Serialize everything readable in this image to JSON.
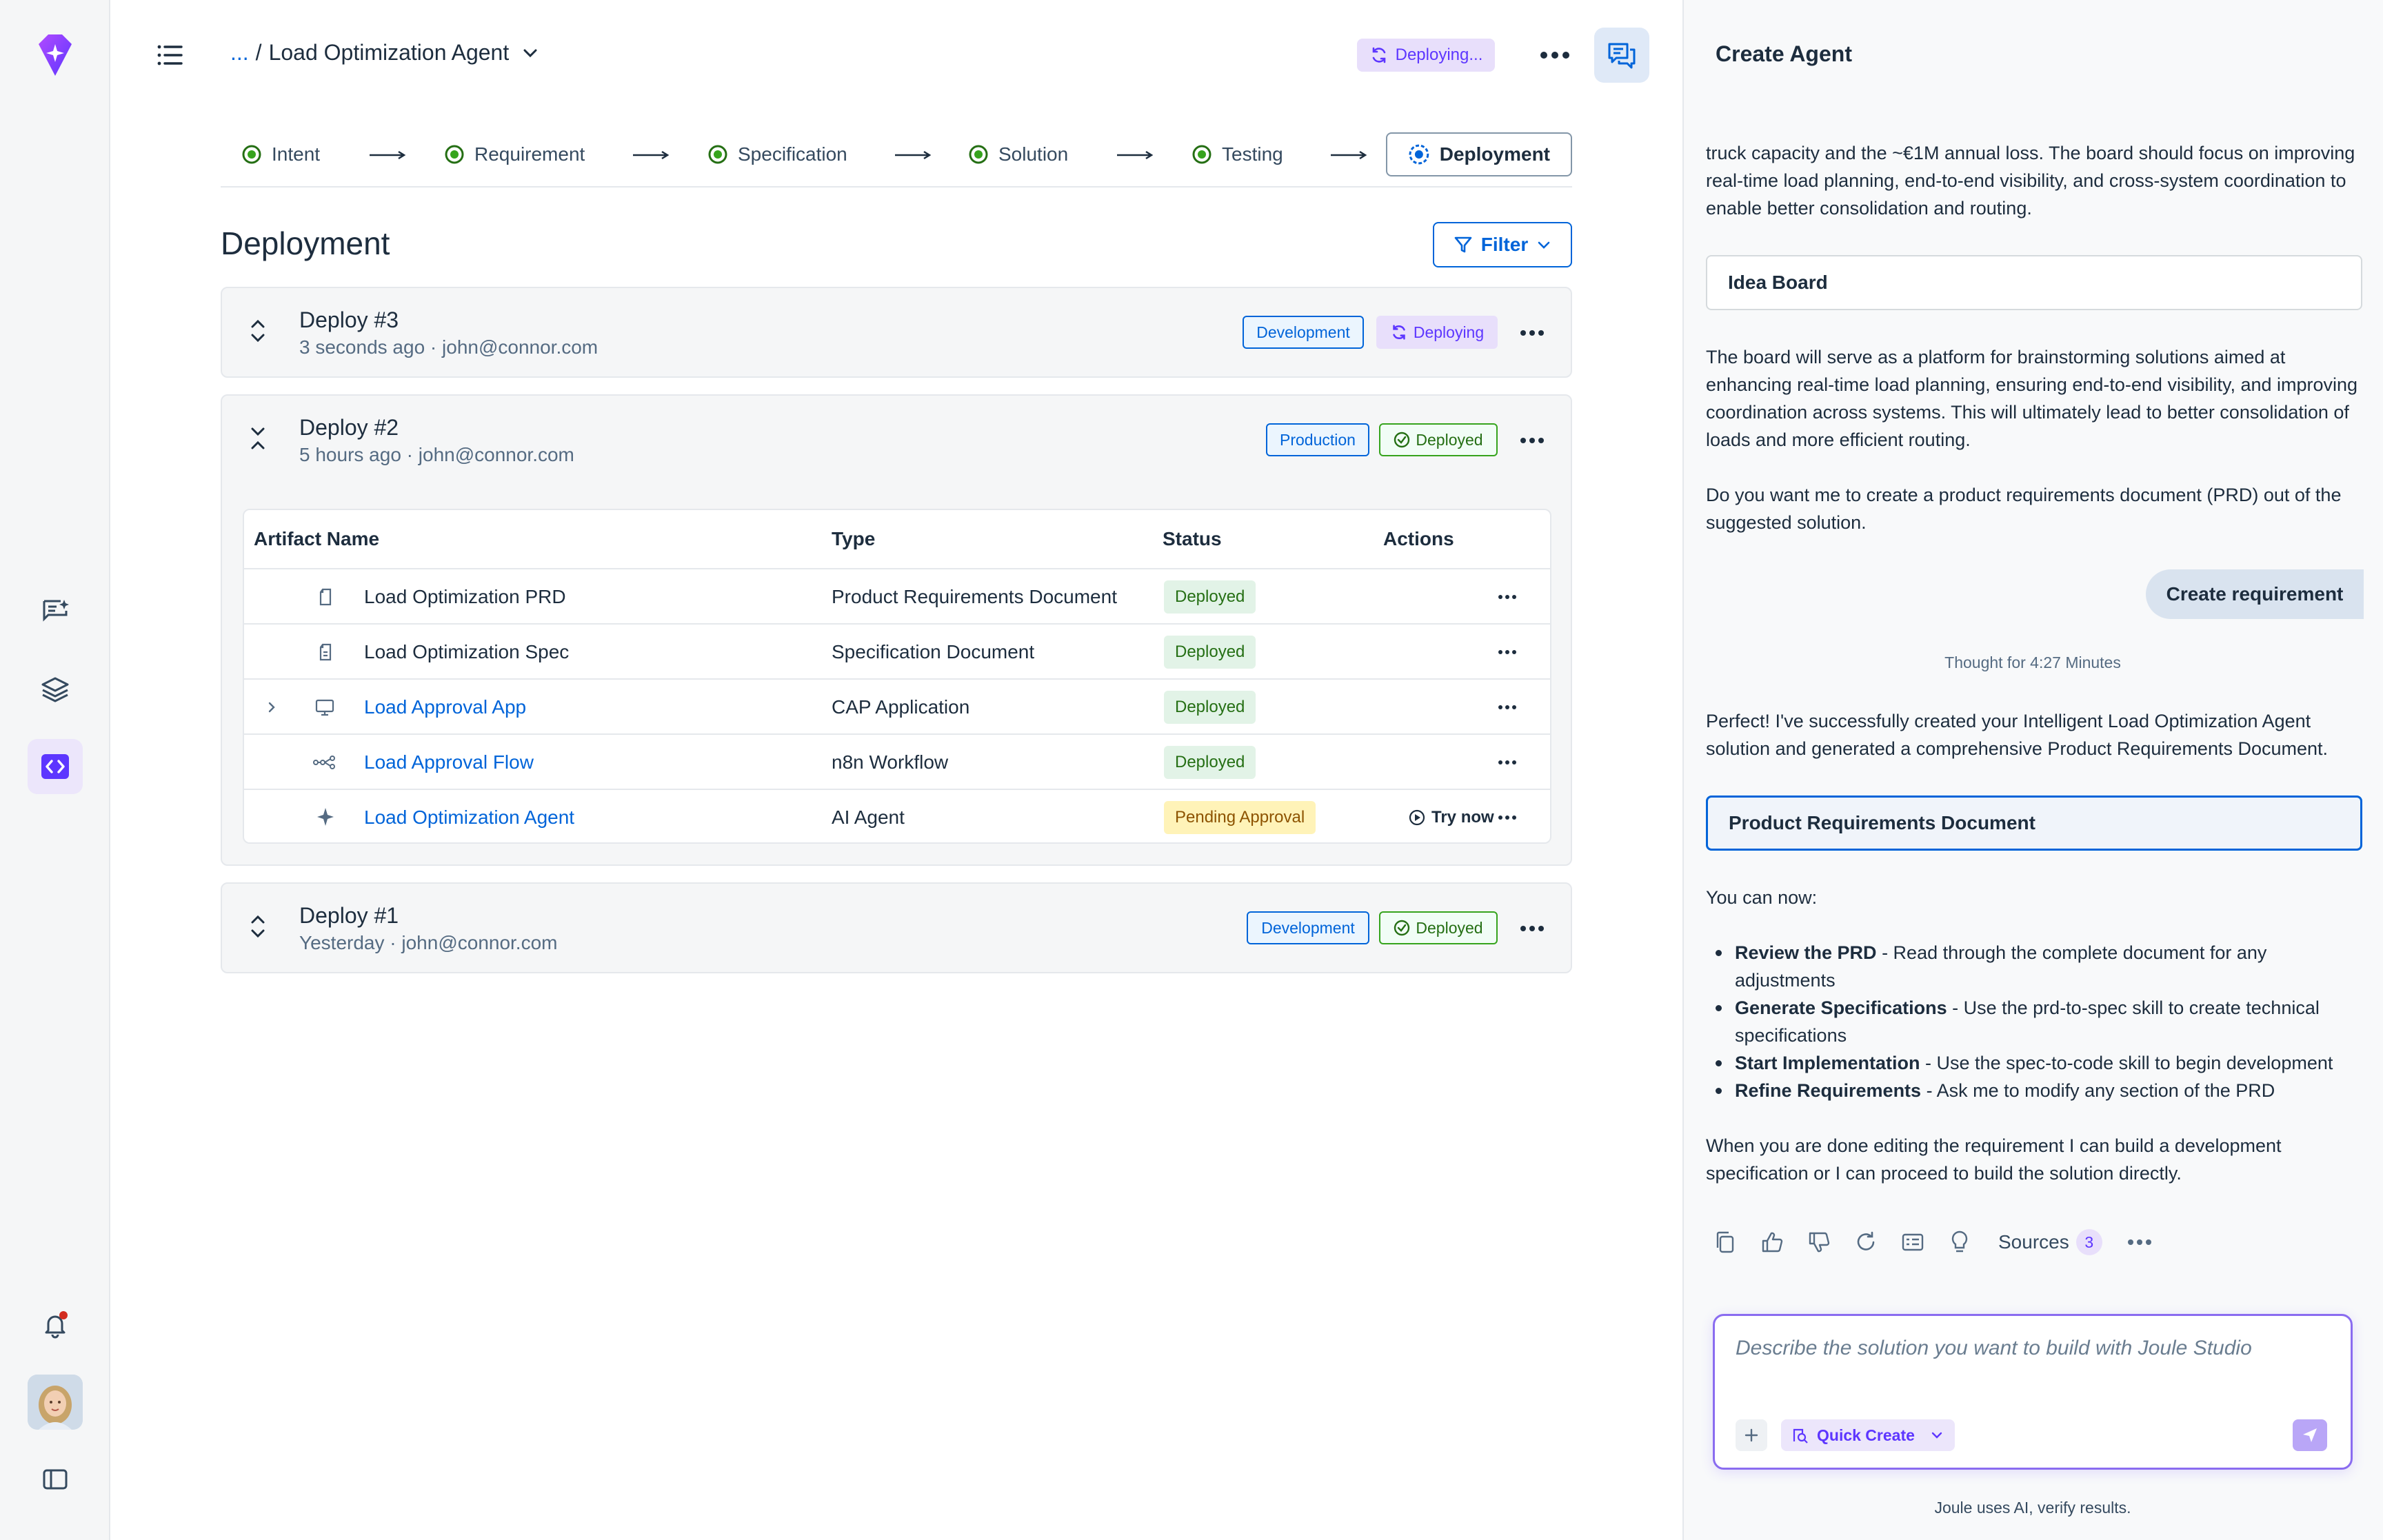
{
  "topbar": {
    "breadcrumb_prefix": "...",
    "breadcrumb_sep": "/",
    "title": "Load Optimization Agent",
    "status_pill": "Deploying..."
  },
  "stepper": [
    {
      "label": "Intent",
      "state": "done"
    },
    {
      "label": "Requirement",
      "state": "done"
    },
    {
      "label": "Specification",
      "state": "done"
    },
    {
      "label": "Solution",
      "state": "done"
    },
    {
      "label": "Testing",
      "state": "done"
    },
    {
      "label": "Deployment",
      "state": "current"
    }
  ],
  "main": {
    "section_title": "Deployment",
    "filter_label": "Filter"
  },
  "deploys": [
    {
      "title": "Deploy #3",
      "subtitle": "3 seconds ago · john@connor.com",
      "env": "Development",
      "status": "Deploying"
    },
    {
      "title": "Deploy #2",
      "subtitle": "5 hours ago · john@connor.com",
      "env": "Production",
      "status": "Deployed"
    },
    {
      "title": "Deploy #1",
      "subtitle": "Yesterday · john@connor.com",
      "env": "Development",
      "status": "Deployed"
    }
  ],
  "artifacts": {
    "columns": [
      "Artifact Name",
      "Type",
      "Status",
      "Actions"
    ],
    "rows": [
      {
        "name": "Load Optimization PRD",
        "type": "Product Requirements Document",
        "status": "Deployed",
        "icon": "document-icon",
        "link": false
      },
      {
        "name": "Load Optimization Spec",
        "type": "Specification Document",
        "status": "Deployed",
        "icon": "spec-document-icon",
        "link": false
      },
      {
        "name": "Load Approval App",
        "type": "CAP Application",
        "status": "Deployed",
        "icon": "monitor-icon",
        "link": true
      },
      {
        "name": "Load Approval Flow",
        "type": "n8n Workflow",
        "status": "Deployed",
        "icon": "workflow-icon",
        "link": true
      },
      {
        "name": "Load Optimization Agent",
        "type": "AI Agent",
        "status": "Pending Approval",
        "icon": "sparkle-icon",
        "link": true,
        "action": "Try now"
      }
    ]
  },
  "side_panel": {
    "title": "Create Agent",
    "intro_text": "truck capacity and the ~€1M annual loss. The board should focus on improving real-time load planning, end-to-end visibility, and cross-system coordination to enable better consolidation and routing.",
    "idea_board_label": "Idea Board",
    "board_text": "The board will serve as a platform for brainstorming solutions aimed at enhancing real-time load planning, ensuring end-to-end visibility, and improving coordination across systems. This will ultimately lead to better consolidation of loads and more efficient routing.",
    "question_text": "Do you want me to create a product requirements document (PRD) out of the suggested solution.",
    "user_message": "Create requirement",
    "thought": "Thought for 4:27 Minutes",
    "success_text": "Perfect! I've successfully created your Intelligent Load Optimization Agent solution and generated a comprehensive Product Requirements Document.",
    "prd_box_label": "Product Requirements Document",
    "you_can_now": "You can now:",
    "options": [
      {
        "bold": "Review the PRD",
        "rest": " - Read through the complete document for any adjustments"
      },
      {
        "bold": "Generate Specifications",
        "rest": " - Use the prd-to-spec skill to create technical specifications"
      },
      {
        "bold": "Start Implementation",
        "rest": " - Use the spec-to-code skill to begin development"
      },
      {
        "bold": "Refine Requirements",
        "rest": " - Ask me to modify any section of the PRD"
      }
    ],
    "closing_text": "When you are done editing the requirement I can build a development specification or I can proceed to build the solution directly.",
    "sources_label": "Sources",
    "sources_count": "3",
    "composer_placeholder": "Describe the solution you want to build with Joule Studio",
    "quick_create_label": "Quick Create",
    "disclaimer": "Joule uses AI, verify results."
  },
  "colors": {
    "brand_purple": "#5d36ff",
    "link_blue": "#0064d9",
    "success_green": "#256f14",
    "pending_amber": "#8d5300"
  }
}
